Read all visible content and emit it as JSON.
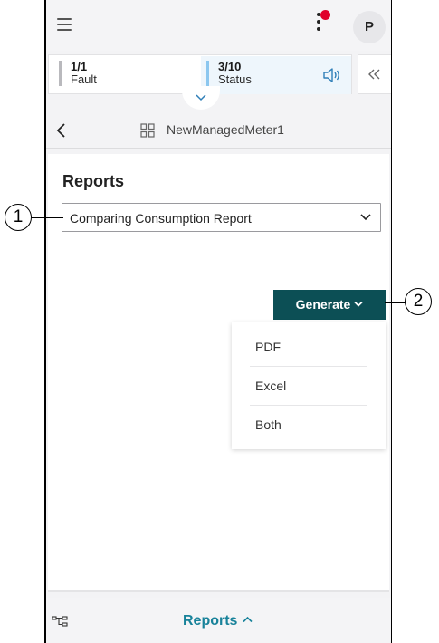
{
  "header": {
    "menu_icon": "hamburger-icon",
    "more_icon": "kebab-icon",
    "notification_color": "#e0002b",
    "avatar_initial": "P"
  },
  "status_bar": {
    "fault": {
      "count": "1/1",
      "label": "Fault"
    },
    "status": {
      "count": "3/10",
      "label": "Status"
    },
    "speaker_icon": "speaker-icon",
    "collapse_icon": "double-chevron-left-icon",
    "expand_icon": "chevron-down-icon"
  },
  "breadcrumb": {
    "back_icon": "chevron-left-icon",
    "device_icon": "grid-icon",
    "title": "NewManagedMeter1"
  },
  "reports": {
    "heading": "Reports",
    "selected_report": "Comparing Consumption Report",
    "generate_label": "Generate",
    "generate_color": "#0c4f55",
    "generate_options": [
      "PDF",
      "Excel",
      "Both"
    ]
  },
  "bottom_nav": {
    "tree_icon": "tree-icon",
    "label": "Reports",
    "accent": "#18829a"
  },
  "callouts": {
    "one": "1",
    "two": "2"
  }
}
